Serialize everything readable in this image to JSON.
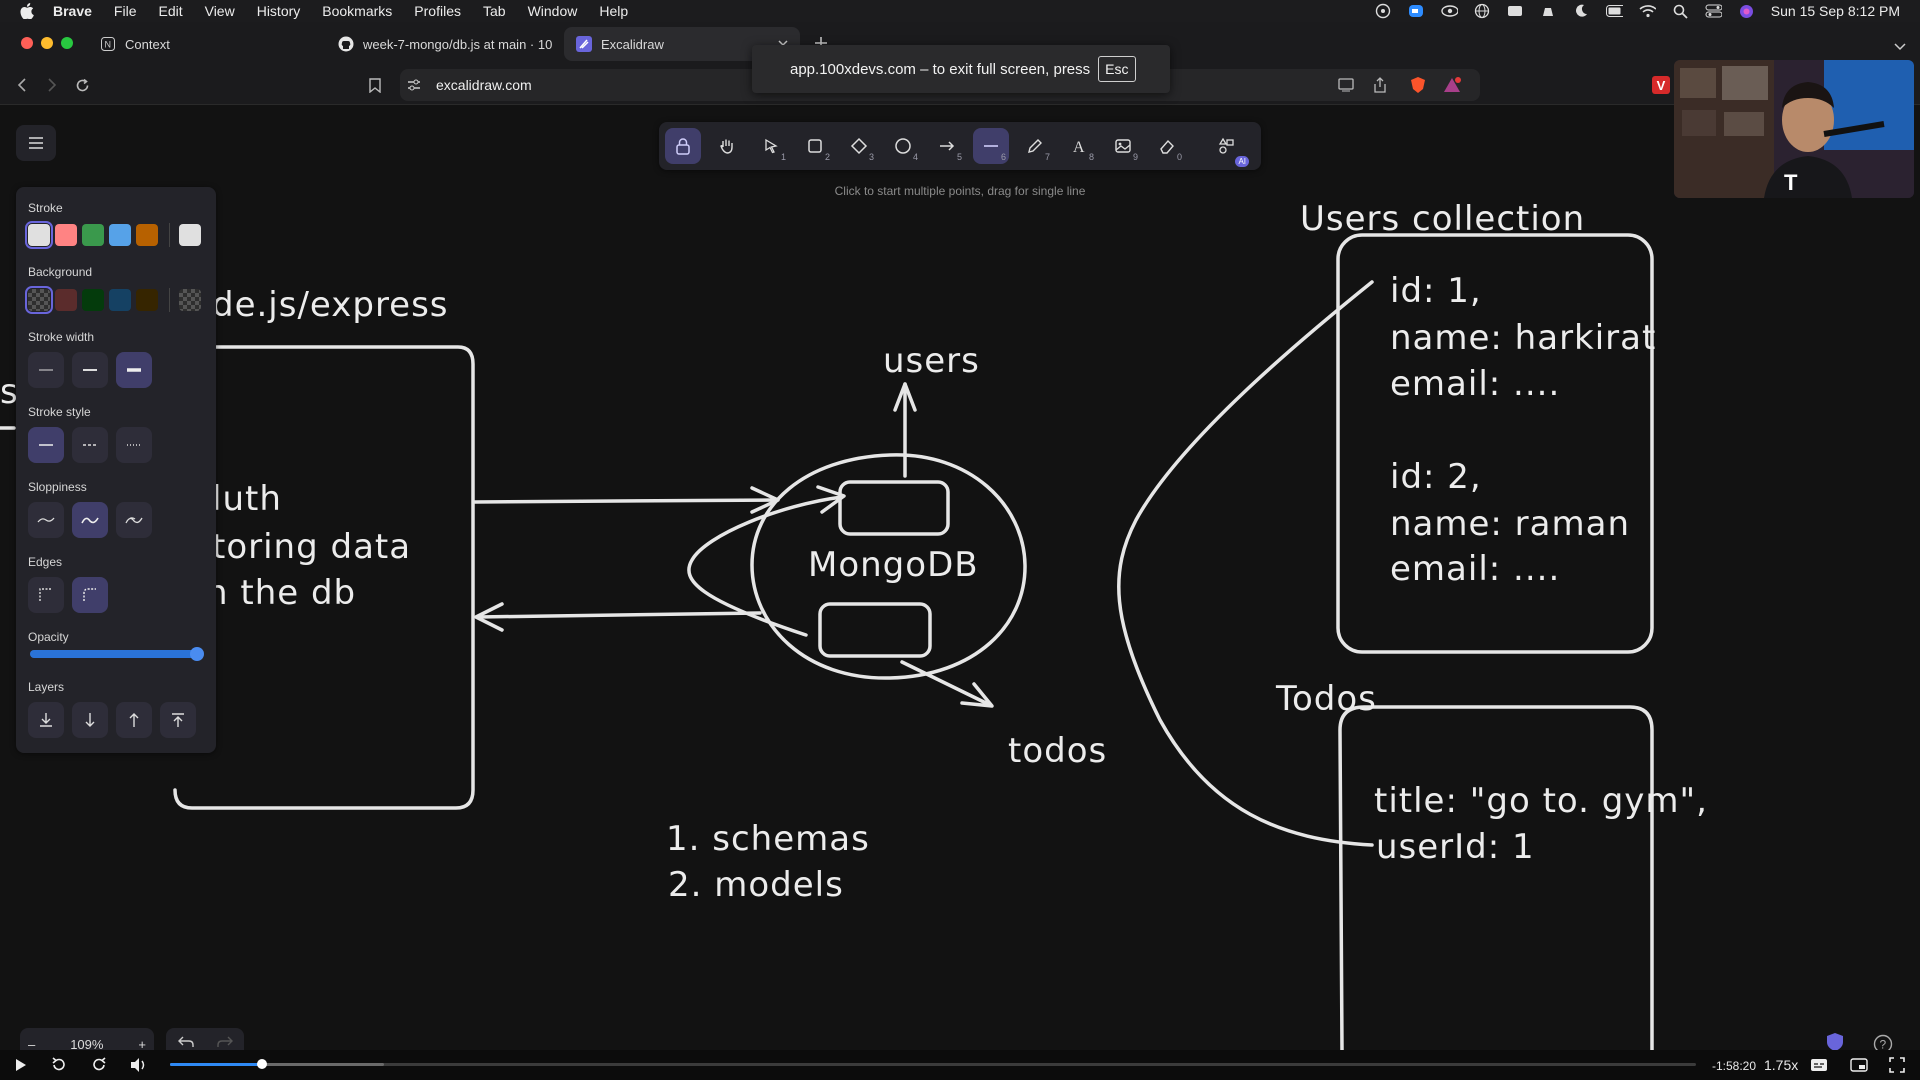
{
  "menubar": {
    "app_name": "Brave",
    "items": [
      "File",
      "Edit",
      "View",
      "History",
      "Bookmarks",
      "Profiles",
      "Tab",
      "Window",
      "Help"
    ],
    "clock": "Sun 15 Sep  8:12 PM"
  },
  "tabs": [
    {
      "label": "Context",
      "icon": "context-icon"
    },
    {
      "label": "week-7-mongo/db.js at main · 10",
      "icon": "github-icon"
    },
    {
      "label": "Excalidraw",
      "icon": "excalidraw-icon"
    }
  ],
  "address": {
    "url": "excalidraw.com"
  },
  "fullscreen_toast": {
    "message": "app.100xdevs.com – to exit full screen, press",
    "key": "Esc"
  },
  "toolbar": {
    "tools": [
      {
        "name": "lock",
        "key": ""
      },
      {
        "name": "hand",
        "key": ""
      },
      {
        "name": "selection",
        "key": "1"
      },
      {
        "name": "rectangle",
        "key": "2"
      },
      {
        "name": "diamond",
        "key": "3"
      },
      {
        "name": "ellipse",
        "key": "4"
      },
      {
        "name": "arrow",
        "key": "5"
      },
      {
        "name": "line",
        "key": "6"
      },
      {
        "name": "draw",
        "key": "7"
      },
      {
        "name": "text",
        "key": "8"
      },
      {
        "name": "image",
        "key": "9"
      },
      {
        "name": "eraser",
        "key": "0"
      },
      {
        "name": "more-tools",
        "key": ""
      }
    ],
    "selected": "line",
    "ai_badge": "AI",
    "hint": "Click to start multiple points, drag for single line"
  },
  "properties": {
    "stroke_label": "Stroke",
    "stroke_colors": [
      "#e0e0e0",
      "#ff8383",
      "#3a994c",
      "#56a2e8",
      "#b76100"
    ],
    "stroke_current": "#e0e0e0",
    "background_label": "Background",
    "background_colors": [
      "transparent",
      "#5b2c2c",
      "#043b0c",
      "#154163",
      "#362500"
    ],
    "stroke_width_label": "Stroke width",
    "stroke_style_label": "Stroke style",
    "sloppiness_label": "Sloppiness",
    "edges_label": "Edges",
    "opacity_label": "Opacity",
    "opacity": 100,
    "layers_label": "Layers"
  },
  "canvas": {
    "texts": {
      "server_title": "de.js/express",
      "server_line1": "luth",
      "server_line2": "toring data",
      "server_line3": "n the db",
      "left_edge": "s",
      "users": "users",
      "mongodb": "MongoDB",
      "todos": "todos",
      "list1": "1.  schemas",
      "list2": "2.  models",
      "users_collection": "Users collection",
      "u1_id": "id:  1,",
      "u1_name": "name:  harkirat",
      "u1_email": "email:  ....",
      "u2_id": "id:  2,",
      "u2_name": "name:  raman",
      "u2_email": "email:  ....",
      "todos_title": "Todos",
      "todo_title": "title:  \"go  to.  gym\",",
      "todo_user": "userId:  1"
    }
  },
  "zoom": {
    "minus": "–",
    "level": "109%",
    "plus": "+"
  },
  "player": {
    "time_left": "-1:58:20",
    "speed": "1.75x",
    "progress": 0.06
  }
}
